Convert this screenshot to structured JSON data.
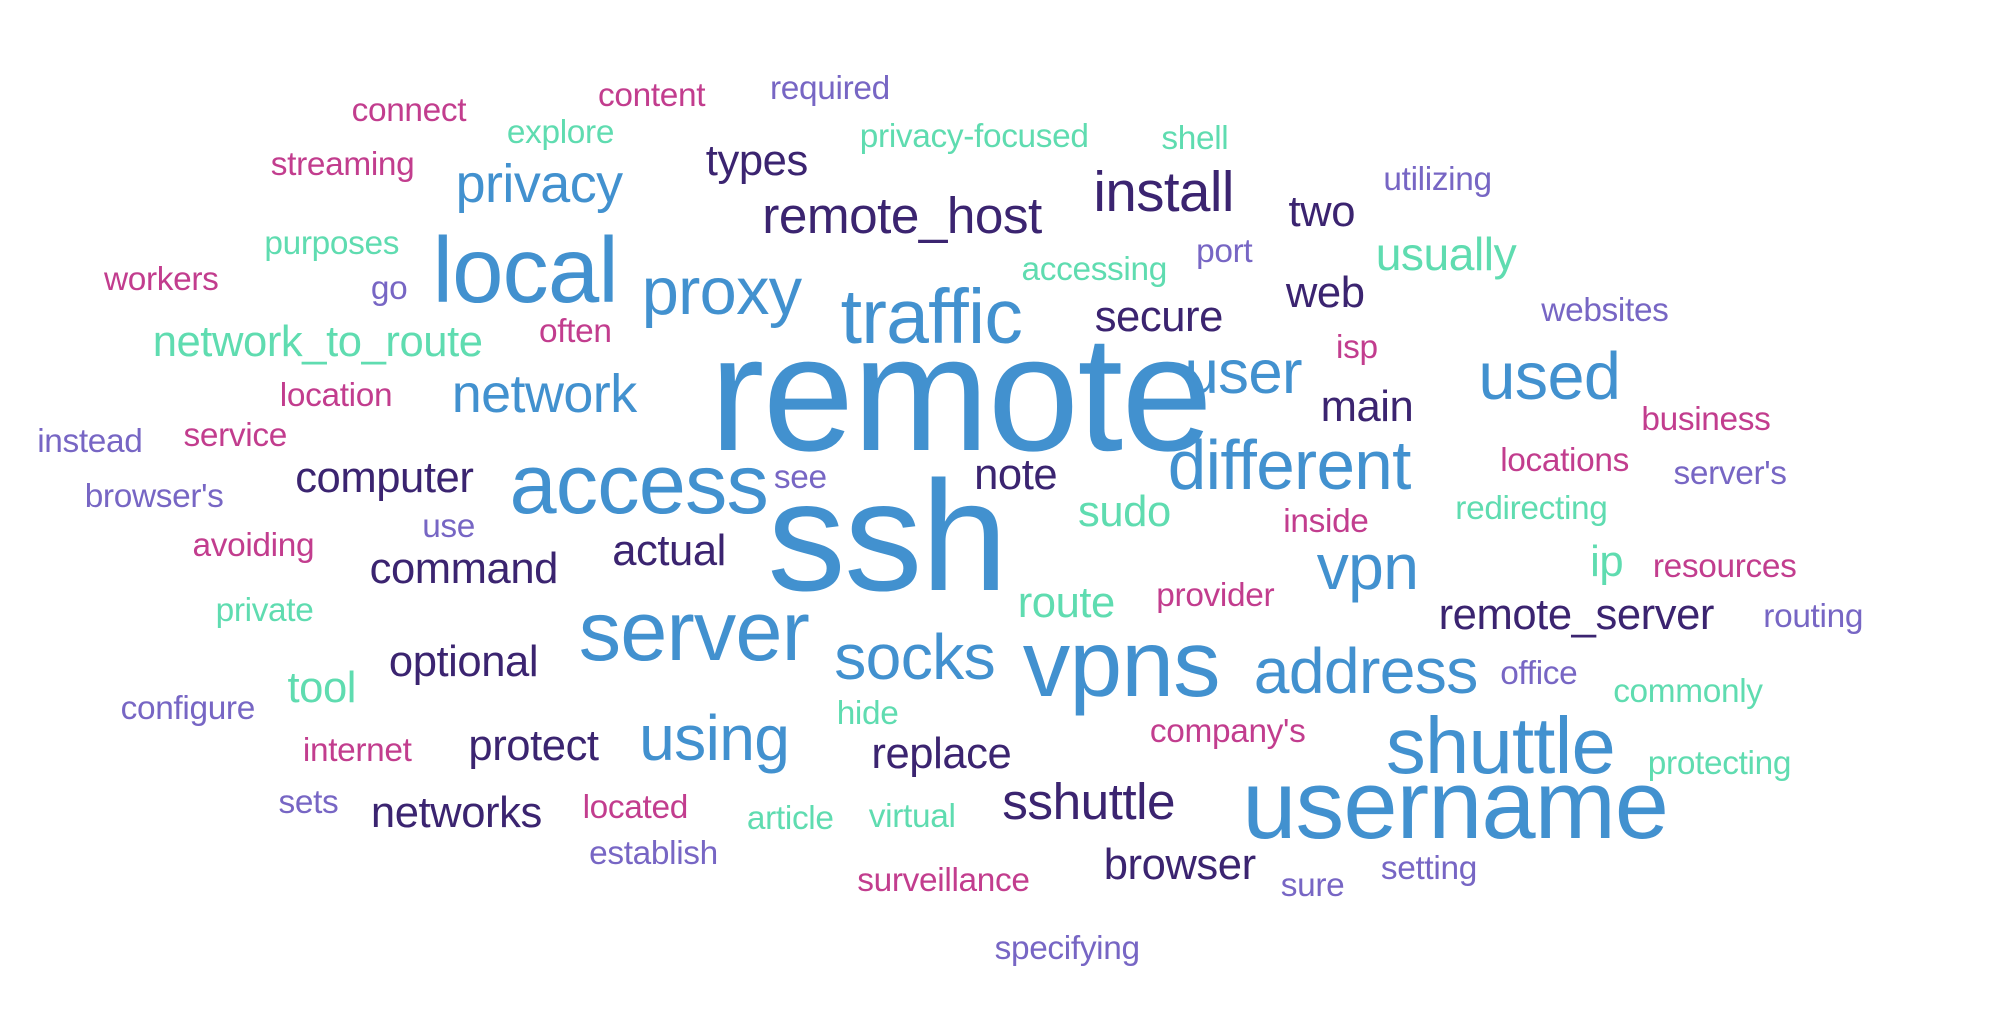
{
  "title": "",
  "palette": {
    "blue": "#4291cf",
    "dark_purple": "#3b2470",
    "mint": "#5fdcb0",
    "magenta": "#c23d8e",
    "lavender": "#7766c4"
  },
  "words": [
    {
      "text": "remote",
      "color": "blue"
    },
    {
      "text": "ssh",
      "color": "blue"
    },
    {
      "text": "vpns",
      "color": "blue"
    },
    {
      "text": "username",
      "color": "blue"
    },
    {
      "text": "local",
      "color": "blue"
    },
    {
      "text": "access",
      "color": "blue"
    },
    {
      "text": "server",
      "color": "blue"
    },
    {
      "text": "traffic",
      "color": "blue"
    },
    {
      "text": "shuttle",
      "color": "blue"
    },
    {
      "text": "different",
      "color": "blue"
    },
    {
      "text": "used",
      "color": "blue"
    },
    {
      "text": "proxy",
      "color": "blue"
    },
    {
      "text": "socks",
      "color": "blue"
    },
    {
      "text": "address",
      "color": "blue"
    },
    {
      "text": "using",
      "color": "blue"
    },
    {
      "text": "vpn",
      "color": "blue"
    },
    {
      "text": "user",
      "color": "blue"
    },
    {
      "text": "network",
      "color": "blue"
    },
    {
      "text": "privacy",
      "color": "blue"
    },
    {
      "text": "install",
      "color": "dark_purple"
    },
    {
      "text": "remote_host",
      "color": "dark_purple"
    },
    {
      "text": "sshuttle",
      "color": "dark_purple"
    },
    {
      "text": "computer",
      "color": "dark_purple"
    },
    {
      "text": "command",
      "color": "dark_purple"
    },
    {
      "text": "optional",
      "color": "dark_purple"
    },
    {
      "text": "protect",
      "color": "dark_purple"
    },
    {
      "text": "networks",
      "color": "dark_purple"
    },
    {
      "text": "replace",
      "color": "dark_purple"
    },
    {
      "text": "browser",
      "color": "dark_purple"
    },
    {
      "text": "remote_server",
      "color": "dark_purple"
    },
    {
      "text": "secure",
      "color": "dark_purple"
    },
    {
      "text": "actual",
      "color": "dark_purple"
    },
    {
      "text": "note",
      "color": "dark_purple"
    },
    {
      "text": "main",
      "color": "dark_purple"
    },
    {
      "text": "types",
      "color": "dark_purple"
    },
    {
      "text": "two",
      "color": "dark_purple"
    },
    {
      "text": "web",
      "color": "dark_purple"
    },
    {
      "text": "usually",
      "color": "mint"
    },
    {
      "text": "network_to_route",
      "color": "mint"
    },
    {
      "text": "route",
      "color": "mint"
    },
    {
      "text": "sudo",
      "color": "mint"
    },
    {
      "text": "tool",
      "color": "mint"
    },
    {
      "text": "ip",
      "color": "mint"
    },
    {
      "text": "privacy-focused",
      "color": "mint"
    },
    {
      "text": "explore",
      "color": "mint"
    },
    {
      "text": "shell",
      "color": "mint"
    },
    {
      "text": "purposes",
      "color": "mint"
    },
    {
      "text": "accessing",
      "color": "mint"
    },
    {
      "text": "redirecting",
      "color": "mint"
    },
    {
      "text": "private",
      "color": "mint"
    },
    {
      "text": "commonly",
      "color": "mint"
    },
    {
      "text": "hide",
      "color": "mint"
    },
    {
      "text": "protecting",
      "color": "mint"
    },
    {
      "text": "article",
      "color": "mint"
    },
    {
      "text": "virtual",
      "color": "mint"
    },
    {
      "text": "connect",
      "color": "magenta"
    },
    {
      "text": "content",
      "color": "magenta"
    },
    {
      "text": "streaming",
      "color": "magenta"
    },
    {
      "text": "workers",
      "color": "magenta"
    },
    {
      "text": "often",
      "color": "magenta"
    },
    {
      "text": "location",
      "color": "magenta"
    },
    {
      "text": "service",
      "color": "magenta"
    },
    {
      "text": "avoiding",
      "color": "magenta"
    },
    {
      "text": "isp",
      "color": "magenta"
    },
    {
      "text": "business",
      "color": "magenta"
    },
    {
      "text": "locations",
      "color": "magenta"
    },
    {
      "text": "inside",
      "color": "magenta"
    },
    {
      "text": "resources",
      "color": "magenta"
    },
    {
      "text": "provider",
      "color": "magenta"
    },
    {
      "text": "company's",
      "color": "magenta"
    },
    {
      "text": "internet",
      "color": "magenta"
    },
    {
      "text": "located",
      "color": "magenta"
    },
    {
      "text": "surveillance",
      "color": "magenta"
    },
    {
      "text": "required",
      "color": "lavender"
    },
    {
      "text": "utilizing",
      "color": "lavender"
    },
    {
      "text": "port",
      "color": "lavender"
    },
    {
      "text": "go",
      "color": "lavender"
    },
    {
      "text": "websites",
      "color": "lavender"
    },
    {
      "text": "instead",
      "color": "lavender"
    },
    {
      "text": "browser's",
      "color": "lavender"
    },
    {
      "text": "see",
      "color": "lavender"
    },
    {
      "text": "use",
      "color": "lavender"
    },
    {
      "text": "server's",
      "color": "lavender"
    },
    {
      "text": "routing",
      "color": "lavender"
    },
    {
      "text": "office",
      "color": "lavender"
    },
    {
      "text": "configure",
      "color": "lavender"
    },
    {
      "text": "sets",
      "color": "lavender"
    },
    {
      "text": "establish",
      "color": "lavender"
    },
    {
      "text": "sure",
      "color": "lavender"
    },
    {
      "text": "setting",
      "color": "lavender"
    },
    {
      "text": "specifying",
      "color": "lavender"
    }
  ]
}
